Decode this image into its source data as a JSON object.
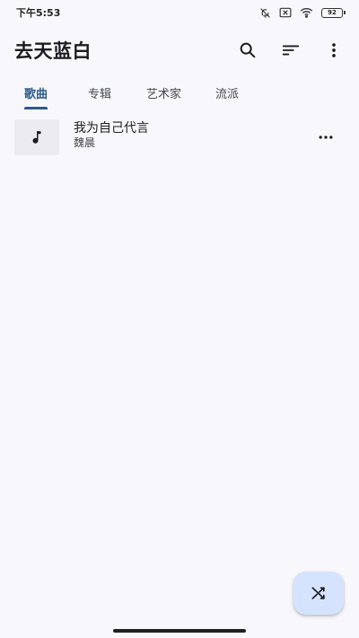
{
  "status_bar": {
    "time": "下午5:53",
    "battery_level": "92",
    "icons": [
      "bell-off-icon",
      "sim-disabled-icon",
      "wifi-icon",
      "battery-icon"
    ]
  },
  "app_bar": {
    "title": "去天蓝白",
    "actions": [
      "search-icon",
      "sort-icon",
      "more-vert-icon"
    ]
  },
  "tabs": [
    {
      "label": "歌曲",
      "active": true
    },
    {
      "label": "专辑",
      "active": false
    },
    {
      "label": "艺术家",
      "active": false
    },
    {
      "label": "流派",
      "active": false
    }
  ],
  "songs": [
    {
      "title": "我为自己代言",
      "artist": "魏晨",
      "art_icon": "music-note-icon",
      "menu_icon": "more-horiz-icon"
    }
  ],
  "fab": {
    "icon": "shuffle-icon"
  },
  "colors": {
    "background": "#f8f8fc",
    "accent": "#2d5b89",
    "fab_background": "#d6e3ff",
    "album_placeholder": "#ececf0"
  }
}
